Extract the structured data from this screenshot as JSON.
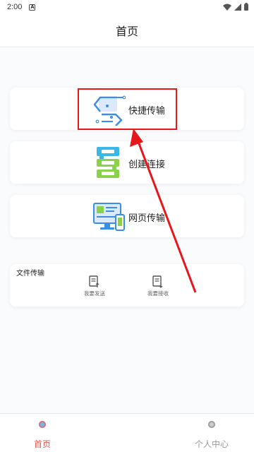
{
  "status_bar": {
    "time": "2:00",
    "app_badge": "A"
  },
  "header": {
    "title": "首页"
  },
  "cards": {
    "quick_transfer": {
      "label": "快捷传输",
      "icon": "transfer-arrows-icon"
    },
    "create_connection": {
      "label": "创建连接",
      "icon": "server-stack-icon"
    },
    "web_transfer": {
      "label": "网页传输",
      "icon": "desktop-phone-icon"
    }
  },
  "file_transfer": {
    "heading": "文件传输",
    "send_label": "我要发送",
    "receive_label": "我要接收"
  },
  "bottom_nav": {
    "home_label": "首页",
    "profile_label": "个人中心"
  },
  "colors": {
    "accent_active": "#e8564c",
    "inactive": "#999999",
    "annotation": "#e8151b",
    "icon_blue": "#3a8ee6",
    "icon_green": "#8bd24b"
  }
}
